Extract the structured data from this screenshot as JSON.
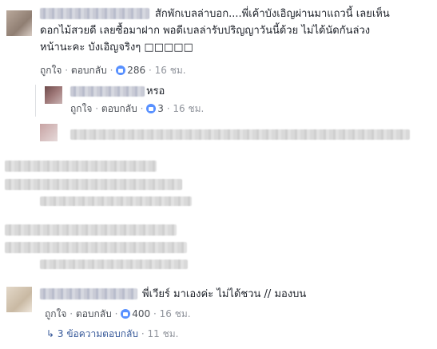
{
  "comments": [
    {
      "text_line1": "สักพักเบลล่าบอก....พี่เค้าบังเอิญผ่านมาแถวนี้ เลยเห็น",
      "text_line2": "ดอกไม้สวยดี เลยซื้อมาฝาก พอดีเบลล่ารับปริญญาวันนี้ด้วย ไม่ได้นัดกันล่วง",
      "text_line3": "หน้านะคะ บังเอิญจริงๆ □□□□□",
      "like_label": "ถูกใจ",
      "reply_label": "ตอบกลับ",
      "likes": "286",
      "time": "16 ชม."
    },
    {
      "text": "หรอ",
      "like_label": "ถูกใจ",
      "reply_label": "ตอบกลับ",
      "likes": "3",
      "time": "16 ชม."
    },
    {
      "text": "พี่เวียร์ มาเองค่ะ ไม่ได้ชวน // มองบน",
      "like_label": "ถูกใจ",
      "reply_label": "ตอบกลับ",
      "likes": "400",
      "time": "16 ชม."
    }
  ],
  "replies_summary": {
    "text": "3 ข้อความตอบกลับ",
    "time": "11 ชม."
  },
  "separator": "·",
  "colors": {
    "link": "#365899",
    "meta": "#90949c",
    "like_blue": "#5890ff"
  }
}
